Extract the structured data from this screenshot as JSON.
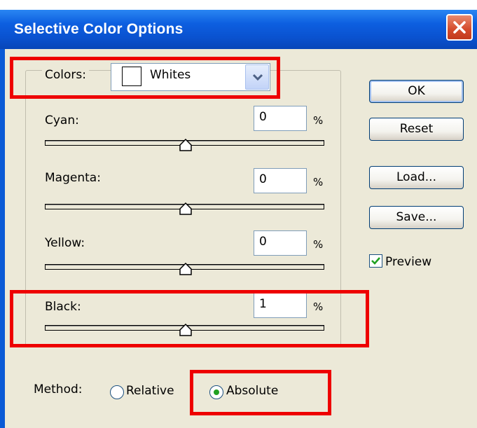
{
  "window": {
    "title": "Selective Color Options",
    "close_icon": "close-x-icon"
  },
  "colors": {
    "label": "Colors:",
    "selected": "Whites",
    "dropdown_icon": "chevron-down-icon"
  },
  "sliders": [
    {
      "label": "Cyan:",
      "value": "0",
      "unit": "%",
      "level": 0.5
    },
    {
      "label": "Magenta:",
      "value": "0",
      "unit": "%",
      "level": 0.5
    },
    {
      "label": "Yellow:",
      "value": "0",
      "unit": "%",
      "level": 0.5
    },
    {
      "label": "Black:",
      "value": "1",
      "unit": "%",
      "level": 0.5
    }
  ],
  "buttons": {
    "ok": "OK",
    "reset": "Reset",
    "load": "Load...",
    "save": "Save..."
  },
  "preview": {
    "label": "Preview",
    "checked": true
  },
  "method": {
    "label": "Method:",
    "options": [
      {
        "label": "Relative",
        "selected": false
      },
      {
        "label": "Absolute",
        "selected": true
      }
    ]
  },
  "colors_accent": {
    "titlebar": "#0a52d0",
    "highlight_box": "#ee0000",
    "check": "#21a121"
  }
}
